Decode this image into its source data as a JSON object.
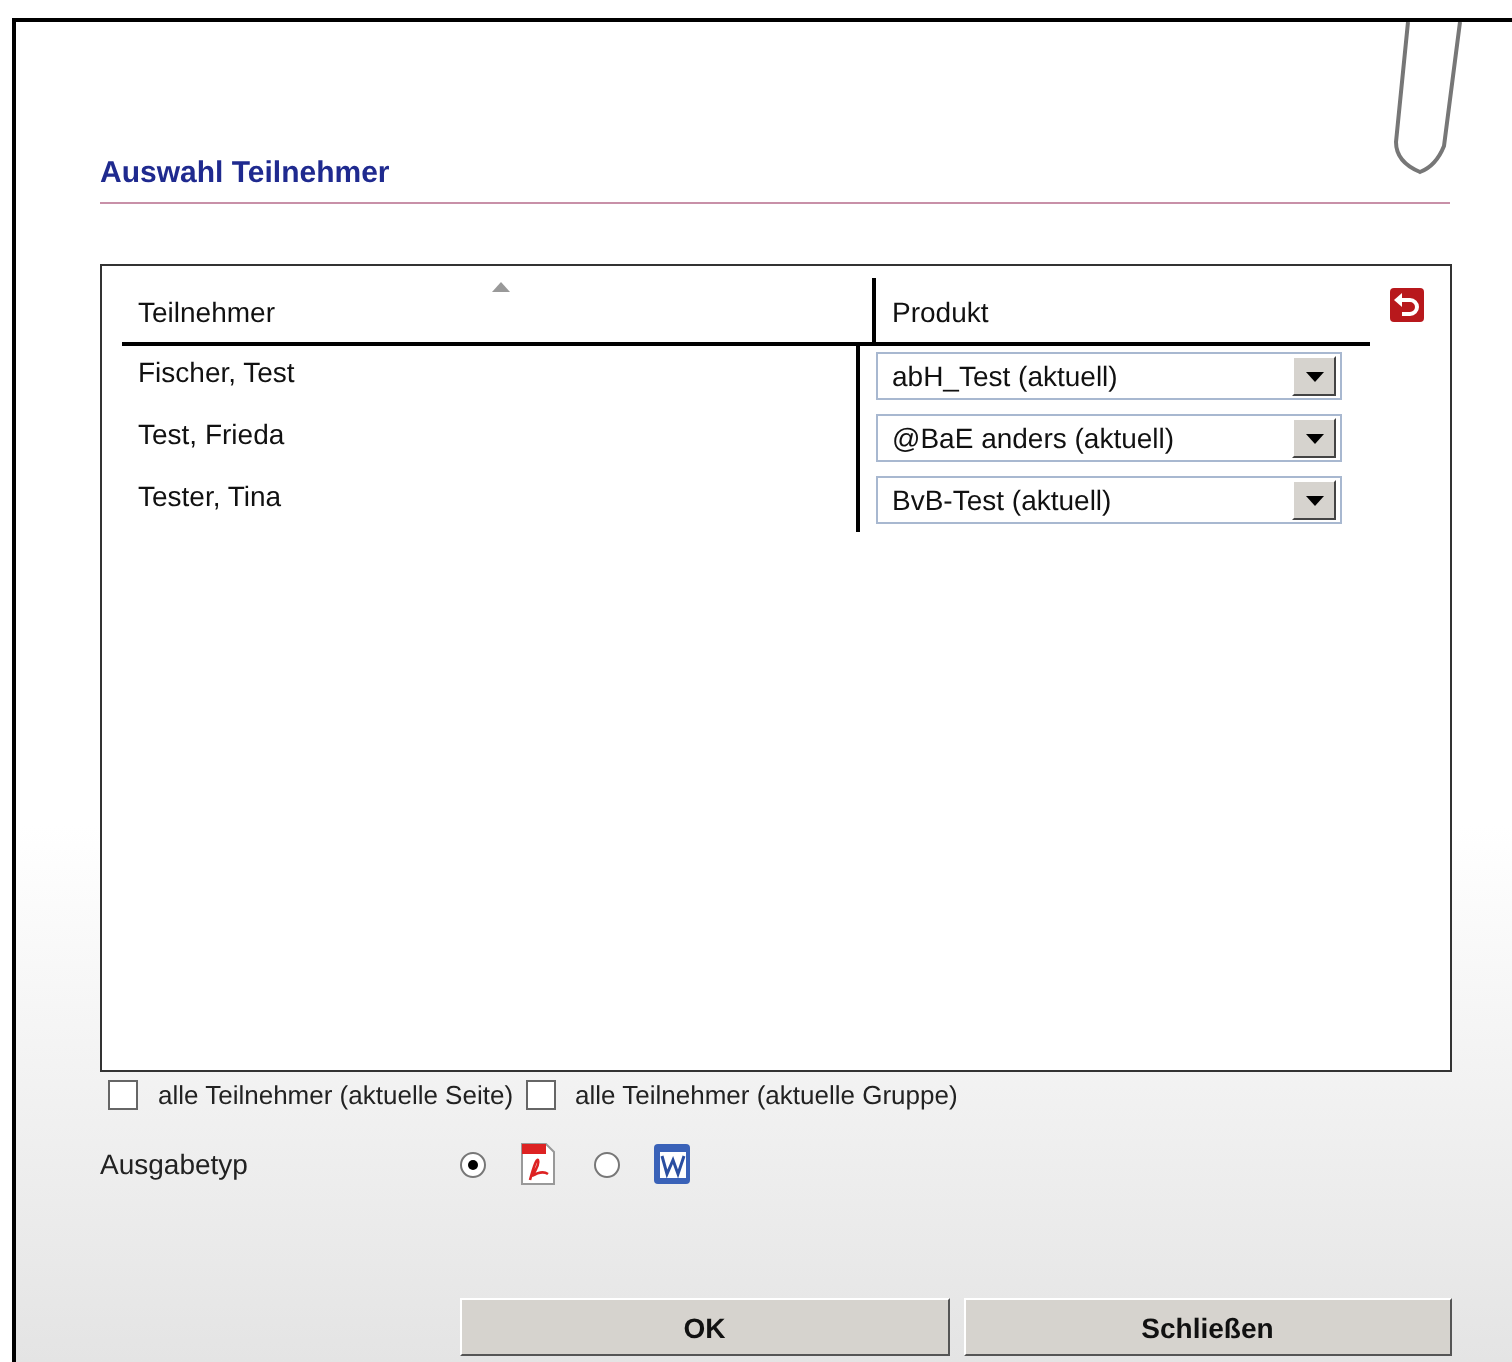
{
  "title": "Auswahl Teilnehmer",
  "table": {
    "columns": [
      {
        "label": "Teilnehmer",
        "sorted": true
      },
      {
        "label": "Produkt",
        "sorted": false
      }
    ],
    "rows": [
      {
        "name": "Fischer, Test",
        "product": "abH_Test (aktuell)"
      },
      {
        "name": "Test, Frieda",
        "product": "@BaE anders (aktuell)"
      },
      {
        "name": "Tester, Tina",
        "product": "BvB-Test (aktuell)"
      }
    ]
  },
  "options": [
    {
      "label": "alle Teilnehmer (aktuelle Seite)",
      "checked": false
    },
    {
      "label": "alle Teilnehmer (aktuelle Gruppe)",
      "checked": false
    }
  ],
  "output": {
    "label": "Ausgabetyp",
    "choices": [
      {
        "kind": "pdf",
        "selected": true
      },
      {
        "kind": "word",
        "selected": false
      }
    ]
  },
  "buttons": [
    "OK",
    "Schließen"
  ]
}
